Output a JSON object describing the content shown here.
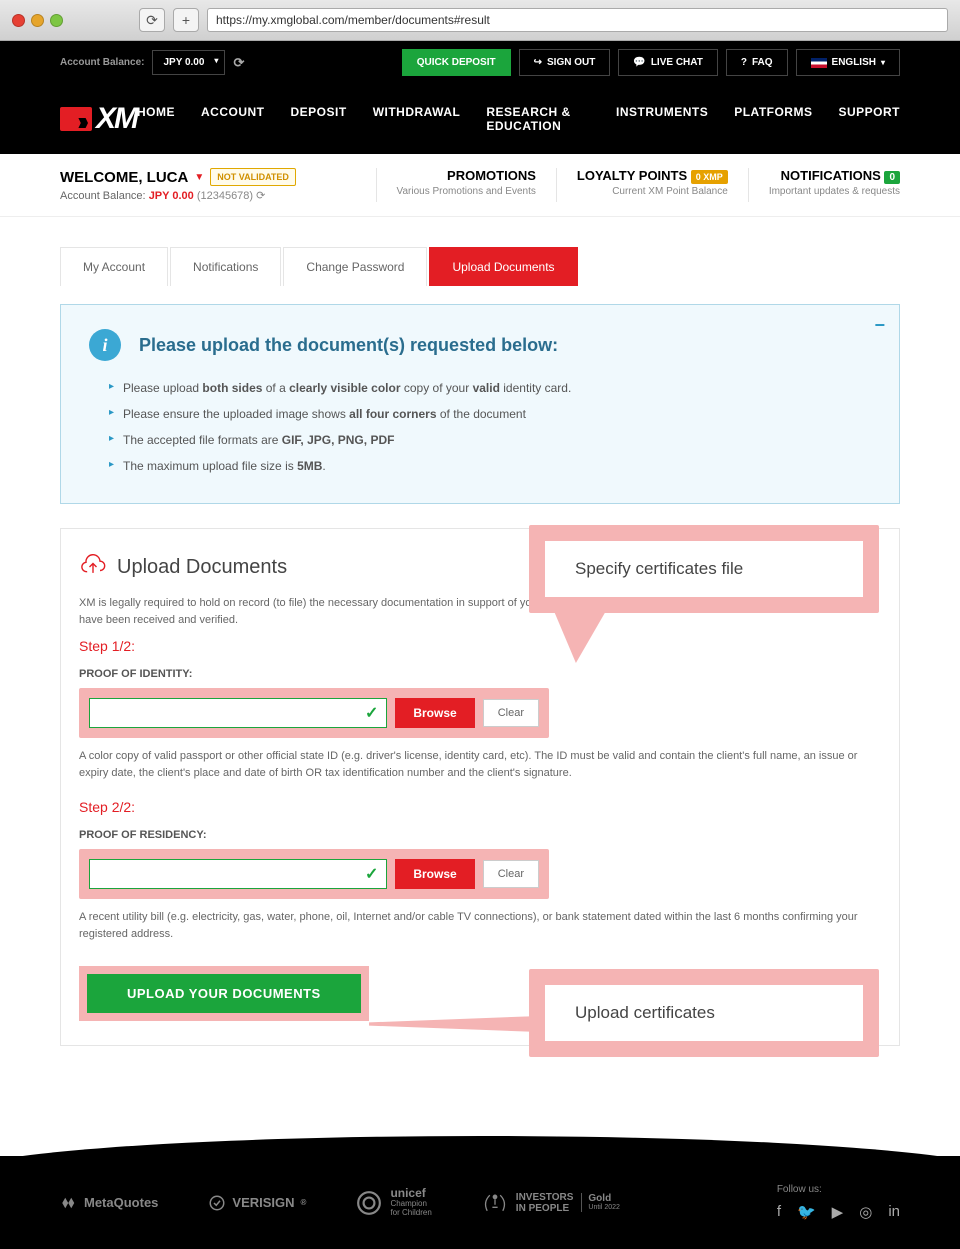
{
  "browser": {
    "url": "https://my.xmglobal.com/member/documents#result"
  },
  "topbar": {
    "balance_label": "Account Balance:",
    "balance_value": "JPY 0.00",
    "quick_deposit": "QUICK DEPOSIT",
    "sign_out": "SIGN OUT",
    "live_chat": "LIVE CHAT",
    "faq": "FAQ",
    "language": "ENGLISH"
  },
  "nav": {
    "items": [
      "HOME",
      "ACCOUNT",
      "DEPOSIT",
      "WITHDRAWAL",
      "RESEARCH & EDUCATION",
      "INSTRUMENTS",
      "PLATFORMS",
      "SUPPORT"
    ]
  },
  "welcome": {
    "greeting": "WELCOME, LUCA",
    "badge": "NOT VALIDATED",
    "balance_label": "Account Balance:",
    "balance_amount": "JPY 0.00",
    "account_number": "(12345678)",
    "promotions_title": "PROMOTIONS",
    "promotions_sub": "Various Promotions and Events",
    "loyalty_title": "LOYALTY POINTS",
    "loyalty_badge": "0 XMP",
    "loyalty_sub": "Current XM Point Balance",
    "notif_title": "NOTIFICATIONS",
    "notif_count": "0",
    "notif_sub": "Important updates & requests"
  },
  "tabs": {
    "my_account": "My Account",
    "notifications": "Notifications",
    "change_password": "Change Password",
    "upload_documents": "Upload Documents"
  },
  "info": {
    "title": "Please upload the document(s) requested below:",
    "bullets": {
      "b1a": "Please upload ",
      "b1b": "both sides",
      "b1c": " of a ",
      "b1d": "clearly visible color",
      "b1e": " copy of your ",
      "b1f": "valid",
      "b1g": " identity card.",
      "b2a": "Please ensure the uploaded image shows ",
      "b2b": "all four corners",
      "b2c": " of the document",
      "b3a": "The accepted file formats are ",
      "b3b": "GIF, JPG, PNG, PDF",
      "b4a": "The maximum upload file size is ",
      "b4b": "5MB",
      "b4c": "."
    }
  },
  "upload": {
    "title": "Upload Documents",
    "desc": "XM is legally required to hold on record (to file) the necessary documentation in support of your trading account. Your account will be validated once your documents have been received and verified.",
    "step1": "Step 1/2:",
    "proof_identity_label": "PROOF OF IDENTITY:",
    "browse": "Browse",
    "clear": "Clear",
    "identity_desc": "A color copy of valid passport or other official state ID (e.g. driver's license, identity card, etc). The ID must be valid and contain the client's full name, an issue or expiry date, the client's place and date of birth OR tax identification number and the client's signature.",
    "step2": "Step 2/2:",
    "proof_residency_label": "PROOF OF RESIDENCY:",
    "residency_desc": "A recent utility bill (e.g. electricity, gas, water, phone, oil, Internet and/or cable TV connections), or bank statement dated within the last 6 months confirming your registered address.",
    "submit": "UPLOAD YOUR DOCUMENTS"
  },
  "callouts": {
    "specify": "Specify certificates file",
    "upload": "Upload certificates"
  },
  "footer": {
    "metaquotes": "MetaQuotes",
    "verisign": "VERISIGN",
    "unicef1": "unicef",
    "unicef2": "Champion",
    "unicef3": "for Children",
    "iip1": "INVESTORS",
    "iip2": "IN PEOPLE",
    "iip3": "Gold",
    "iip4": "Until 2022",
    "follow": "Follow us:"
  }
}
